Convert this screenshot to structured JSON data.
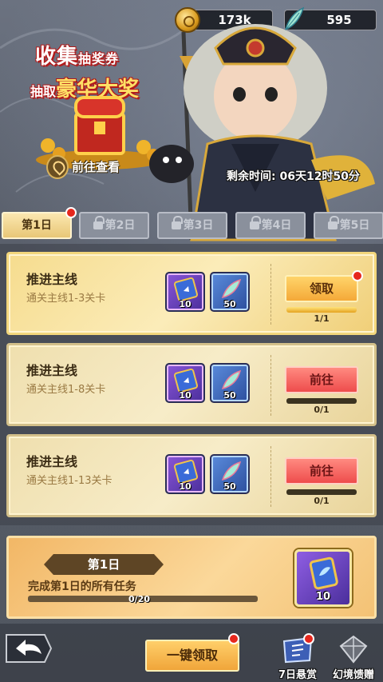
{
  "currency": {
    "gold": {
      "icon": "gold-coin-icon",
      "value": "173k"
    },
    "feather": {
      "icon": "feather-icon",
      "value": "595"
    }
  },
  "promo": {
    "line1_big": "收集",
    "line1_small": "抽奖券",
    "line2_small": "抽取",
    "line2_big": "豪华大奖",
    "goto_label": "前往查看"
  },
  "timer": "剩余时间: 06天12时50分",
  "tabs": [
    {
      "label": "第1日",
      "active": true,
      "locked": false,
      "dot": true
    },
    {
      "label": "第2日",
      "active": false,
      "locked": true,
      "dot": false
    },
    {
      "label": "第3日",
      "active": false,
      "locked": true,
      "dot": false
    },
    {
      "label": "第4日",
      "active": false,
      "locked": true,
      "dot": false
    },
    {
      "label": "第5日",
      "active": false,
      "locked": true,
      "dot": false
    }
  ],
  "tasks": [
    {
      "name": "推进主线",
      "desc": "通关主线1-3关卡",
      "rewards": [
        {
          "type": "ticket",
          "count": "10"
        },
        {
          "type": "wing",
          "count": "50"
        }
      ],
      "action": "领取",
      "action_type": "claim",
      "progress_text": "1/1",
      "progress": 1.0,
      "dot": true
    },
    {
      "name": "推进主线",
      "desc": "通关主线1-8关卡",
      "rewards": [
        {
          "type": "ticket",
          "count": "10"
        },
        {
          "type": "wing",
          "count": "50"
        }
      ],
      "action": "前往",
      "action_type": "go",
      "progress_text": "0/1",
      "progress": 0.0,
      "dot": false
    },
    {
      "name": "推进主线",
      "desc": "通关主线1-13关卡",
      "rewards": [
        {
          "type": "ticket",
          "count": "10"
        },
        {
          "type": "wing",
          "count": "50"
        }
      ],
      "action": "前往",
      "action_type": "go",
      "progress_text": "0/1",
      "progress": 0.0,
      "dot": false
    }
  ],
  "day_panel": {
    "badge": "第1日",
    "desc": "完成第1日的所有任务",
    "progress_text": "0/20",
    "progress": 0.0,
    "reward_count": "10"
  },
  "bottom": {
    "one_click": "一键领取",
    "bounty_label": "7日悬赏",
    "gift_label": "幻境馈赠"
  }
}
